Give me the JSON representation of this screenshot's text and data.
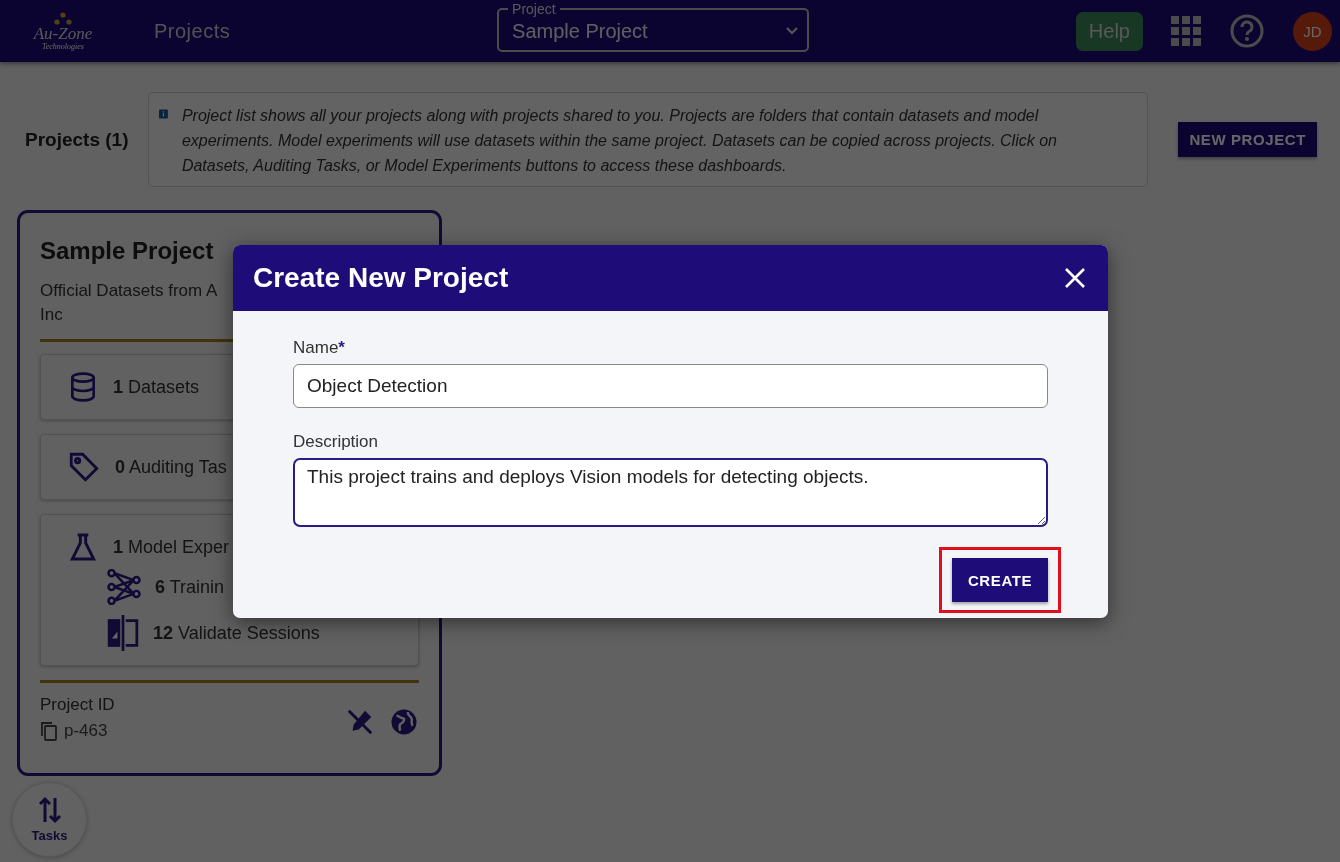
{
  "header": {
    "logo": "Au-Zone",
    "logo_sub": "Technologies",
    "title": "Projects",
    "project_select": {
      "label": "Project",
      "value": "Sample Project"
    },
    "help": "Help",
    "avatar": "JD"
  },
  "toolbar": {
    "heading": "Projects (1)",
    "info": "Project list shows all your projects along with projects shared to you. Projects are folders that contain datasets and model experiments. Model experiments will use datasets within the same project. Datasets can be copied across projects. Click on Datasets, Auditing Tasks, or Model Experiments buttons to access these dashboards.",
    "new_button": "NEW PROJECT"
  },
  "card": {
    "title": "Sample Project",
    "description_lines": [
      "Official Datasets from A",
      "Inc"
    ],
    "stats": [
      {
        "kind": "datasets",
        "count": "1",
        "label": "Datasets"
      },
      {
        "kind": "auditing",
        "count": "0",
        "label": "Auditing Tas"
      },
      {
        "kind": "experiments",
        "count": "1",
        "label": "Model Exper",
        "children": [
          {
            "kind": "training",
            "count": "6",
            "label": "Trainin"
          },
          {
            "kind": "validate",
            "count": "12",
            "label": "Validate Sessions"
          }
        ]
      }
    ],
    "id_label": "Project ID",
    "id_value": "p-463"
  },
  "tasks": {
    "label": "Tasks"
  },
  "dialog": {
    "title": "Create New Project",
    "name_label": "Name",
    "required_mark": "*",
    "name_value": "Object Detection",
    "description_label": "Description",
    "description_value": "This project trains and deploys Vision models for detecting objects. ",
    "create": "CREATE",
    "create_highlighted": true
  }
}
